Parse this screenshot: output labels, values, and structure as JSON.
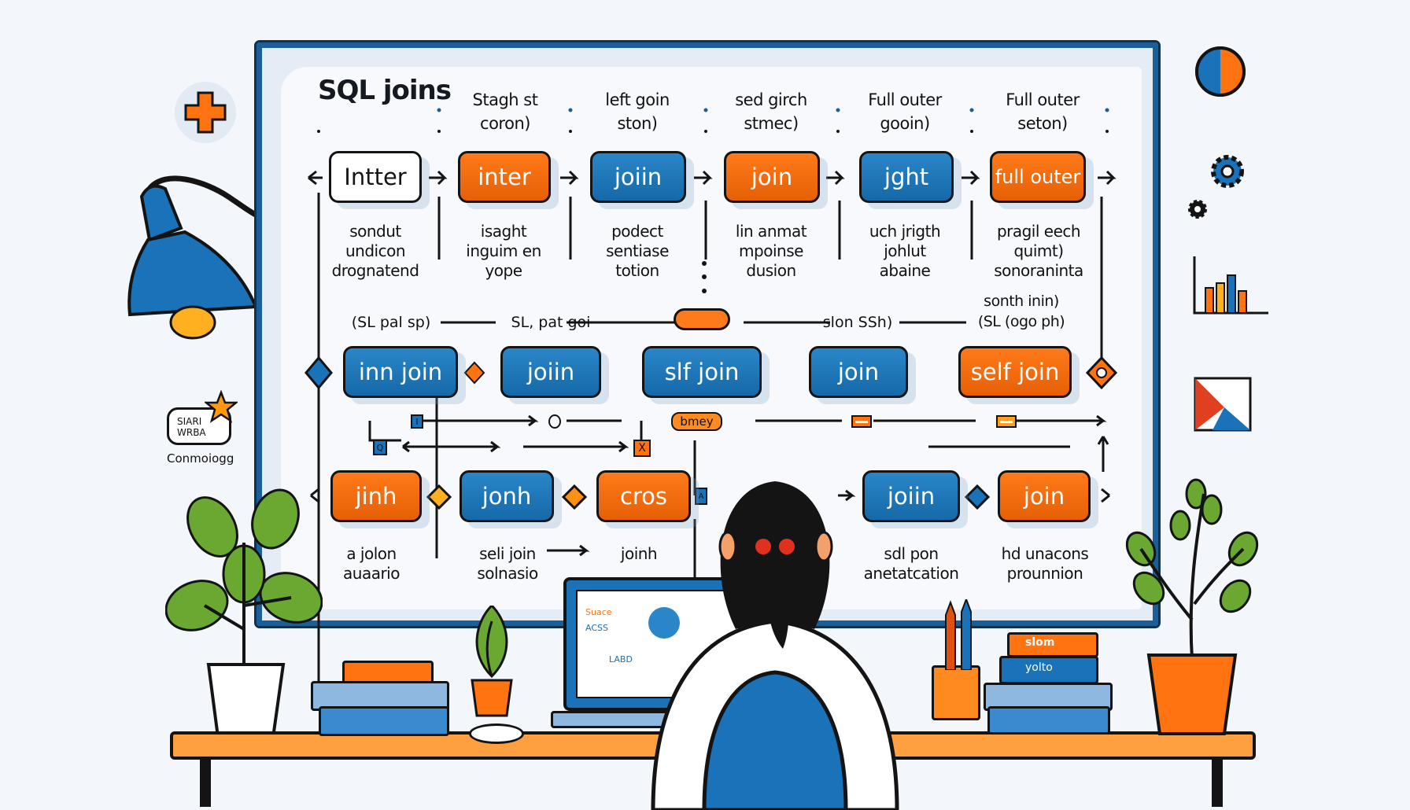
{
  "board": {
    "title": "SQL joins",
    "row1": {
      "headers": [
        "Stagh  st\ncoron)",
        "left goin\nston)",
        "sed girch\nstmec)",
        "Full outer\ngooin)",
        "Full outer\nseton)"
      ],
      "boxes": [
        "Intter",
        "inter",
        "joiin",
        "join",
        "jght",
        "full outer"
      ],
      "captions": [
        "sondut\nundicon\ndrognatend",
        "isaght\ninguim en\nyope",
        "podect\nsentiase\ntotion",
        "lin anmat\nmpoinse\ndusion",
        "uch jrigth\njohlut\nabaine",
        "pragil eech\nquimt)\nsonoraninta"
      ]
    },
    "row2": {
      "labels": [
        "(SL pal sp)",
        "SL, pat goi",
        "slon SSh)",
        "sonth inin)\n(SL (ogo ph)"
      ],
      "boxes": [
        "inn join",
        "joiin",
        "slf join",
        "join",
        "self join"
      ],
      "pill_label": "bmey"
    },
    "row3": {
      "boxes": [
        "jinh",
        "jonh",
        "cros",
        "joiin",
        "join"
      ],
      "captions": [
        "a jolon\nauaario",
        "seli join\nsolnasio",
        "joinh",
        "sdl pon\nanetatcation",
        "hd unacons\nprounnion"
      ],
      "tags": [
        "Q",
        "I",
        "A",
        "X"
      ]
    }
  },
  "decor": {
    "left_badge_text": "SIARI\nWRBA",
    "left_caption": "Conmoiogg",
    "laptop_screen_words": [
      "Suace",
      "ACSS",
      "LABD"
    ],
    "book_labels": [
      "slom",
      "yolto"
    ],
    "colors": {
      "blue": "#1a72b8",
      "orange": "#ff7410",
      "ink": "#141414",
      "board_frame": "#1a5f98",
      "background": "#f3f6fa"
    }
  }
}
